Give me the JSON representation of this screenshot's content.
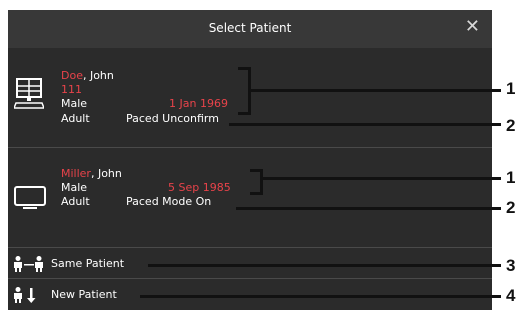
{
  "dialog": {
    "title": "Select Patient"
  },
  "patients": [
    {
      "last_name": "Doe",
      "first_name": ", John",
      "id": "111",
      "gender": "Male",
      "dob": "1 Jan 1969",
      "category": "Adult",
      "paced": "Paced Unconfirm",
      "icon": "computer-icon"
    },
    {
      "last_name": "Miller",
      "first_name": ", John",
      "gender": "Male",
      "dob": "5 Sep 1985",
      "category": "Adult",
      "paced": "Paced Mode On",
      "icon": "monitor-icon"
    }
  ],
  "actions": {
    "same_patient": "Same Patient",
    "new_patient": "New Patient"
  },
  "callouts": [
    "1",
    "2",
    "1",
    "2",
    "3",
    "4"
  ],
  "colors": {
    "accent": "#e8434a",
    "background": "#2b2b2b",
    "header": "#383838"
  }
}
